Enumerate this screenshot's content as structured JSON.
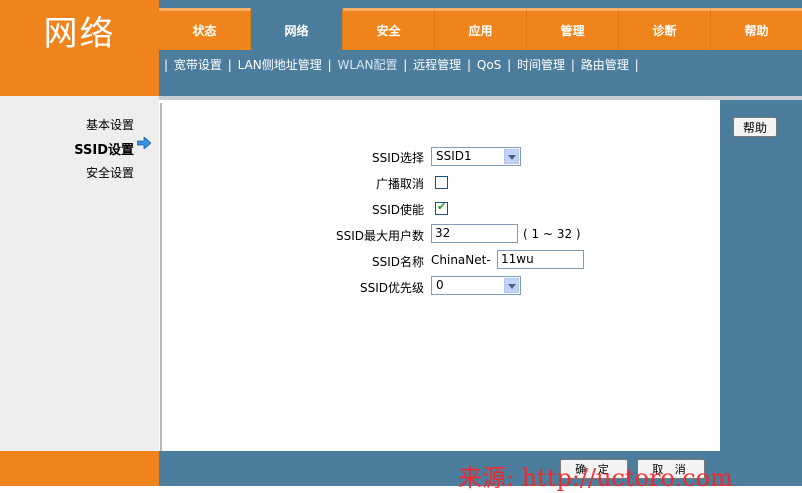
{
  "header": {
    "title": "网络"
  },
  "tabs": [
    {
      "label": "状态"
    },
    {
      "label": "网络"
    },
    {
      "label": "安全"
    },
    {
      "label": "应用"
    },
    {
      "label": "管理"
    },
    {
      "label": "诊断"
    },
    {
      "label": "帮助"
    }
  ],
  "active_tab": "网络",
  "subnav": [
    {
      "label": "宽带设置"
    },
    {
      "label": "LAN侧地址管理"
    },
    {
      "label": "WLAN配置"
    },
    {
      "label": "远程管理"
    },
    {
      "label": "QoS"
    },
    {
      "label": "时间管理"
    },
    {
      "label": "路由管理"
    }
  ],
  "sidebar": [
    {
      "label": "基本设置"
    },
    {
      "label": "SSID设置"
    },
    {
      "label": "安全设置"
    }
  ],
  "help_button": "帮助",
  "form": {
    "ssid_select": {
      "label": "SSID选择",
      "value": "SSID1"
    },
    "broadcast_cancel": {
      "label": "广播取消",
      "checked": false
    },
    "ssid_enable": {
      "label": "SSID使能",
      "checked": true
    },
    "max_users": {
      "label": "SSID最大用户数",
      "value": "32",
      "hint": "( 1 ~ 32 )"
    },
    "ssid_name": {
      "label": "SSID名称",
      "prefix": "ChinaNet-",
      "value": "11wu"
    },
    "ssid_priority": {
      "label": "SSID优先级",
      "value": "0"
    }
  },
  "footer": {
    "confirm": "确 定",
    "cancel": "取 消",
    "watermark": "来源: http://uctoro.com"
  },
  "colors": {
    "orange": "#f0841c",
    "steel_blue": "#4d7d9d"
  }
}
